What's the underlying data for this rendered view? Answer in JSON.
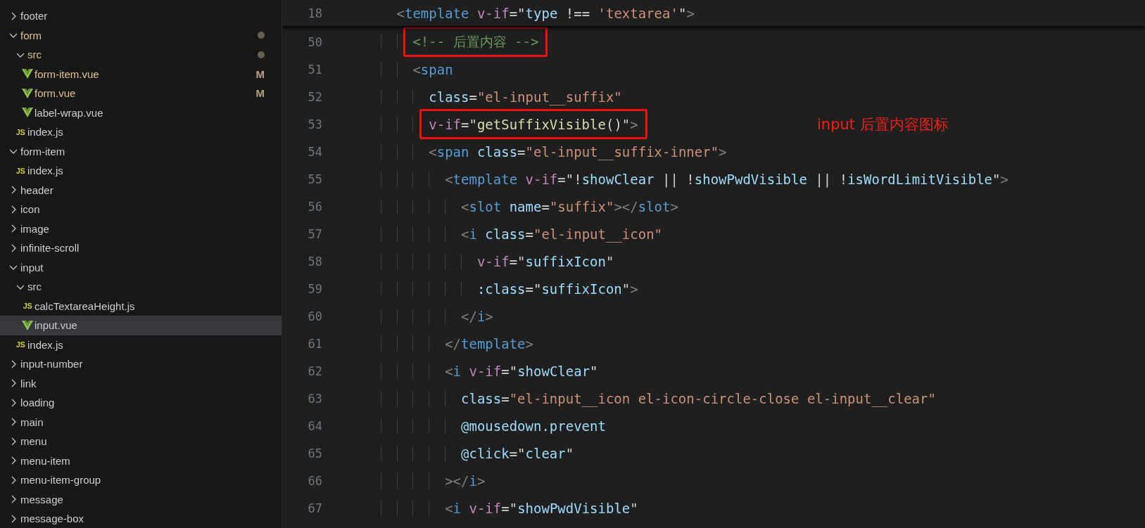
{
  "explorer": {
    "items": [
      {
        "kind": "folder",
        "name": "footer",
        "expanded": false,
        "selected": false,
        "modified": false
      },
      {
        "kind": "folder",
        "name": "form",
        "expanded": true,
        "selected": false,
        "modified": true,
        "children": [
          {
            "kind": "folder",
            "name": "src",
            "expanded": true,
            "selected": false,
            "modified": true,
            "children": [
              {
                "kind": "vue",
                "name": "form-item.vue",
                "selected": false,
                "modified": true,
                "badge": "M"
              },
              {
                "kind": "vue",
                "name": "form.vue",
                "selected": false,
                "modified": true,
                "badge": "M"
              },
              {
                "kind": "vue",
                "name": "label-wrap.vue",
                "selected": false,
                "modified": false
              }
            ]
          },
          {
            "kind": "js",
            "icon_label": "JS",
            "name": "index.js",
            "selected": false,
            "modified": false
          }
        ]
      },
      {
        "kind": "folder",
        "name": "form-item",
        "expanded": true,
        "selected": false,
        "modified": false,
        "children": [
          {
            "kind": "js",
            "icon_label": "JS",
            "name": "index.js",
            "selected": false,
            "modified": false
          }
        ]
      },
      {
        "kind": "folder",
        "name": "header",
        "expanded": false,
        "selected": false,
        "modified": false
      },
      {
        "kind": "folder",
        "name": "icon",
        "expanded": false,
        "selected": false,
        "modified": false
      },
      {
        "kind": "folder",
        "name": "image",
        "expanded": false,
        "selected": false,
        "modified": false
      },
      {
        "kind": "folder",
        "name": "infinite-scroll",
        "expanded": false,
        "selected": false,
        "modified": false
      },
      {
        "kind": "folder",
        "name": "input",
        "expanded": true,
        "selected": false,
        "modified": false,
        "children": [
          {
            "kind": "folder",
            "name": "src",
            "expanded": true,
            "selected": false,
            "modified": false,
            "children": [
              {
                "kind": "js",
                "icon_label": "JS",
                "name": "calcTextareaHeight.js",
                "selected": false,
                "modified": false
              },
              {
                "kind": "vue",
                "name": "input.vue",
                "selected": true,
                "modified": false
              }
            ]
          },
          {
            "kind": "js",
            "icon_label": "JS",
            "name": "index.js",
            "selected": false,
            "modified": false
          }
        ]
      },
      {
        "kind": "folder",
        "name": "input-number",
        "expanded": false,
        "selected": false,
        "modified": false
      },
      {
        "kind": "folder",
        "name": "link",
        "expanded": false,
        "selected": false,
        "modified": false
      },
      {
        "kind": "folder",
        "name": "loading",
        "expanded": false,
        "selected": false,
        "modified": false
      },
      {
        "kind": "folder",
        "name": "main",
        "expanded": false,
        "selected": false,
        "modified": false
      },
      {
        "kind": "folder",
        "name": "menu",
        "expanded": false,
        "selected": false,
        "modified": false
      },
      {
        "kind": "folder",
        "name": "menu-item",
        "expanded": false,
        "selected": false,
        "modified": false
      },
      {
        "kind": "folder",
        "name": "menu-item-group",
        "expanded": false,
        "selected": false,
        "modified": false
      },
      {
        "kind": "folder",
        "name": "message",
        "expanded": false,
        "selected": false,
        "modified": false
      },
      {
        "kind": "folder",
        "name": "message-box",
        "expanded": false,
        "selected": false,
        "modified": false
      }
    ]
  },
  "editor": {
    "sticky_line": {
      "number": "18",
      "tokens": [
        {
          "kind": "punct",
          "text": "        <"
        },
        {
          "kind": "tag",
          "text": "template"
        },
        {
          "kind": "directive",
          "text": " v-if"
        },
        {
          "kind": "op",
          "text": "=\""
        },
        {
          "kind": "ident",
          "text": "type"
        },
        {
          "kind": "op",
          "text": " !== "
        },
        {
          "kind": "string",
          "text": "'textarea'"
        },
        {
          "kind": "op",
          "text": "\""
        },
        {
          "kind": "punct",
          "text": ">"
        }
      ]
    },
    "lines": [
      {
        "number": "50",
        "highlighted": true,
        "tokens": [
          {
            "kind": "comment",
            "text": "          <!-- 后置内容 -->"
          }
        ]
      },
      {
        "number": "51",
        "highlighted": false,
        "tokens": [
          {
            "kind": "punct",
            "text": "          <"
          },
          {
            "kind": "tag",
            "text": "span"
          }
        ]
      },
      {
        "number": "52",
        "highlighted": false,
        "tokens": [
          {
            "kind": "attr",
            "text": "            class"
          },
          {
            "kind": "op",
            "text": "="
          },
          {
            "kind": "string",
            "text": "\"el-input__suffix\""
          }
        ]
      },
      {
        "number": "53",
        "highlighted": true,
        "annotation": "input 后置内容图标",
        "tokens": [
          {
            "kind": "directive",
            "text": "            v-if"
          },
          {
            "kind": "op",
            "text": "=\""
          },
          {
            "kind": "func",
            "text": "getSuffixVisible"
          },
          {
            "kind": "op",
            "text": "()\""
          },
          {
            "kind": "punct",
            "text": ">"
          }
        ]
      },
      {
        "number": "54",
        "highlighted": false,
        "tokens": [
          {
            "kind": "punct",
            "text": "            <"
          },
          {
            "kind": "tag",
            "text": "span"
          },
          {
            "kind": "attr",
            "text": " class"
          },
          {
            "kind": "op",
            "text": "="
          },
          {
            "kind": "string",
            "text": "\"el-input__suffix-inner\""
          },
          {
            "kind": "punct",
            "text": ">"
          }
        ]
      },
      {
        "number": "55",
        "highlighted": false,
        "tokens": [
          {
            "kind": "punct",
            "text": "              <"
          },
          {
            "kind": "tag",
            "text": "template"
          },
          {
            "kind": "directive",
            "text": " v-if"
          },
          {
            "kind": "op",
            "text": "=\"!"
          },
          {
            "kind": "ident",
            "text": "showClear"
          },
          {
            "kind": "op",
            "text": " || !"
          },
          {
            "kind": "ident",
            "text": "showPwdVisible"
          },
          {
            "kind": "op",
            "text": " || !"
          },
          {
            "kind": "ident",
            "text": "isWordLimitVisible"
          },
          {
            "kind": "op",
            "text": "\""
          },
          {
            "kind": "punct",
            "text": ">"
          }
        ]
      },
      {
        "number": "56",
        "highlighted": false,
        "tokens": [
          {
            "kind": "punct",
            "text": "                <"
          },
          {
            "kind": "tag",
            "text": "slot"
          },
          {
            "kind": "attr",
            "text": " name"
          },
          {
            "kind": "op",
            "text": "="
          },
          {
            "kind": "string",
            "text": "\"suffix\""
          },
          {
            "kind": "punct",
            "text": "></"
          },
          {
            "kind": "tag",
            "text": "slot"
          },
          {
            "kind": "punct",
            "text": ">"
          }
        ]
      },
      {
        "number": "57",
        "highlighted": false,
        "tokens": [
          {
            "kind": "punct",
            "text": "                <"
          },
          {
            "kind": "tag",
            "text": "i"
          },
          {
            "kind": "attr",
            "text": " class"
          },
          {
            "kind": "op",
            "text": "="
          },
          {
            "kind": "string",
            "text": "\"el-input__icon\""
          }
        ]
      },
      {
        "number": "58",
        "highlighted": false,
        "tokens": [
          {
            "kind": "directive",
            "text": "                  v-if"
          },
          {
            "kind": "op",
            "text": "=\""
          },
          {
            "kind": "ident",
            "text": "suffixIcon"
          },
          {
            "kind": "op",
            "text": "\""
          }
        ]
      },
      {
        "number": "59",
        "highlighted": false,
        "tokens": [
          {
            "kind": "attr",
            "text": "                  :class"
          },
          {
            "kind": "op",
            "text": "=\""
          },
          {
            "kind": "ident",
            "text": "suffixIcon"
          },
          {
            "kind": "op",
            "text": "\""
          },
          {
            "kind": "punct",
            "text": ">"
          }
        ]
      },
      {
        "number": "60",
        "highlighted": false,
        "tokens": [
          {
            "kind": "punct",
            "text": "                </"
          },
          {
            "kind": "tag",
            "text": "i"
          },
          {
            "kind": "punct",
            "text": ">"
          }
        ]
      },
      {
        "number": "61",
        "highlighted": false,
        "tokens": [
          {
            "kind": "punct",
            "text": "              </"
          },
          {
            "kind": "tag",
            "text": "template"
          },
          {
            "kind": "punct",
            "text": ">"
          }
        ]
      },
      {
        "number": "62",
        "highlighted": false,
        "tokens": [
          {
            "kind": "punct",
            "text": "              <"
          },
          {
            "kind": "tag",
            "text": "i"
          },
          {
            "kind": "directive",
            "text": " v-if"
          },
          {
            "kind": "op",
            "text": "=\""
          },
          {
            "kind": "ident",
            "text": "showClear"
          },
          {
            "kind": "op",
            "text": "\""
          }
        ]
      },
      {
        "number": "63",
        "highlighted": false,
        "tokens": [
          {
            "kind": "attr",
            "text": "                class"
          },
          {
            "kind": "op",
            "text": "="
          },
          {
            "kind": "string",
            "text": "\"el-input__icon el-icon-circle-close el-input__clear\""
          }
        ]
      },
      {
        "number": "64",
        "highlighted": false,
        "tokens": [
          {
            "kind": "attr",
            "text": "                @mousedown.prevent"
          }
        ]
      },
      {
        "number": "65",
        "highlighted": false,
        "tokens": [
          {
            "kind": "attr",
            "text": "                @click"
          },
          {
            "kind": "op",
            "text": "=\""
          },
          {
            "kind": "ident",
            "text": "clear"
          },
          {
            "kind": "op",
            "text": "\""
          }
        ]
      },
      {
        "number": "66",
        "highlighted": false,
        "tokens": [
          {
            "kind": "punct",
            "text": "              ></"
          },
          {
            "kind": "tag",
            "text": "i"
          },
          {
            "kind": "punct",
            "text": ">"
          }
        ]
      },
      {
        "number": "67",
        "highlighted": false,
        "tokens": [
          {
            "kind": "punct",
            "text": "              <"
          },
          {
            "kind": "tag",
            "text": "i"
          },
          {
            "kind": "directive",
            "text": " v-if"
          },
          {
            "kind": "op",
            "text": "=\""
          },
          {
            "kind": "ident",
            "text": "showPwdVisible"
          },
          {
            "kind": "op",
            "text": "\""
          }
        ]
      }
    ]
  }
}
